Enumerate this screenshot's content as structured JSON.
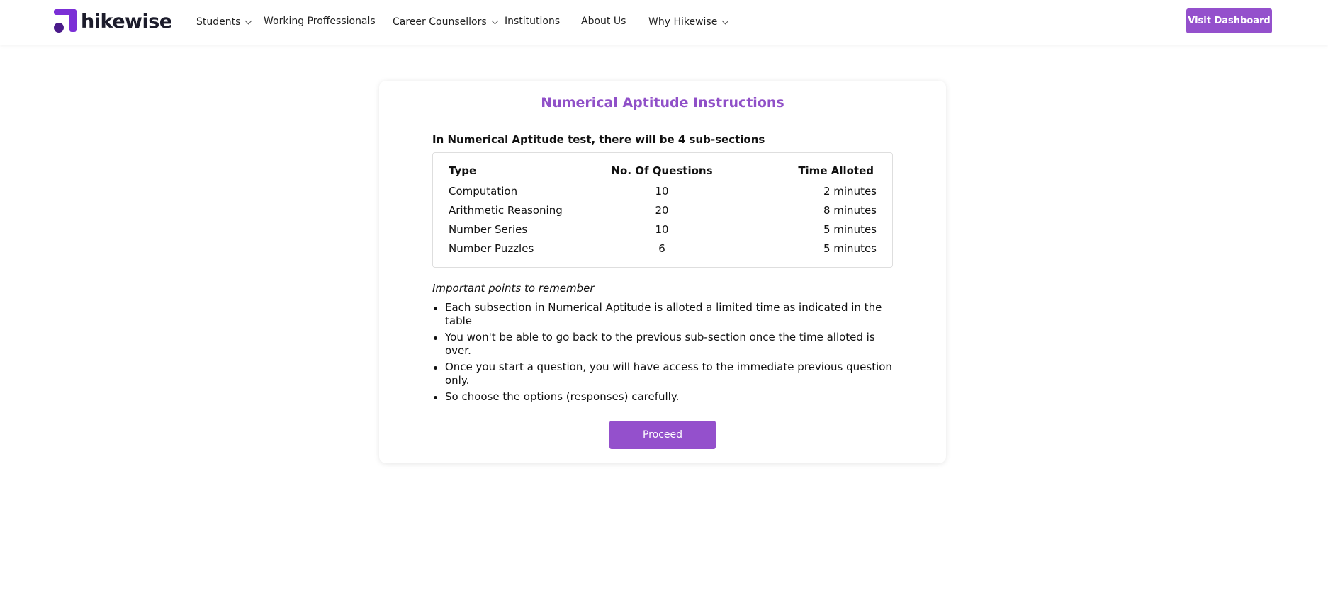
{
  "brand": {
    "name": "hikewise",
    "accent_color": "#9450cc",
    "logo_color": "#7b2fd6"
  },
  "nav": {
    "items": [
      {
        "label": "Students",
        "has_dropdown": true
      },
      {
        "label": "Working Proffessionals",
        "has_dropdown": false
      },
      {
        "label": "Career Counsellors",
        "has_dropdown": true
      },
      {
        "label": "Institutions",
        "has_dropdown": false
      },
      {
        "label": "About Us",
        "has_dropdown": false
      },
      {
        "label": "Why Hikewise",
        "has_dropdown": true
      }
    ],
    "dashboard_button": "Visit Dashboard"
  },
  "instructions": {
    "title": "Numerical Aptitude Instructions",
    "intro_text": "In Numerical Aptitude test, there will be ",
    "intro_emphasis": "4 sub-sections",
    "table": {
      "headers": [
        "Type",
        "No. Of Questions",
        "Time Alloted"
      ],
      "rows": [
        {
          "type": "Computation",
          "questions": "10",
          "time": "2 minutes"
        },
        {
          "type": "Arithmetic Reasoning",
          "questions": "20",
          "time": "8 minutes"
        },
        {
          "type": "Number Series",
          "questions": "10",
          "time": "5 minutes"
        },
        {
          "type": "Number Puzzles",
          "questions": "6",
          "time": "5 minutes"
        }
      ]
    },
    "points_heading": "Important points to remember",
    "points": [
      "Each subsection in Numerical Aptitude is alloted a limited time as indicated in the table",
      "You won't be able to go back to the previous sub-section once the time alloted is over.",
      "Once you start a question, you will have access to the immediate previous question only.",
      "So choose the options (responses) carefully."
    ],
    "proceed_button": "Proceed"
  }
}
